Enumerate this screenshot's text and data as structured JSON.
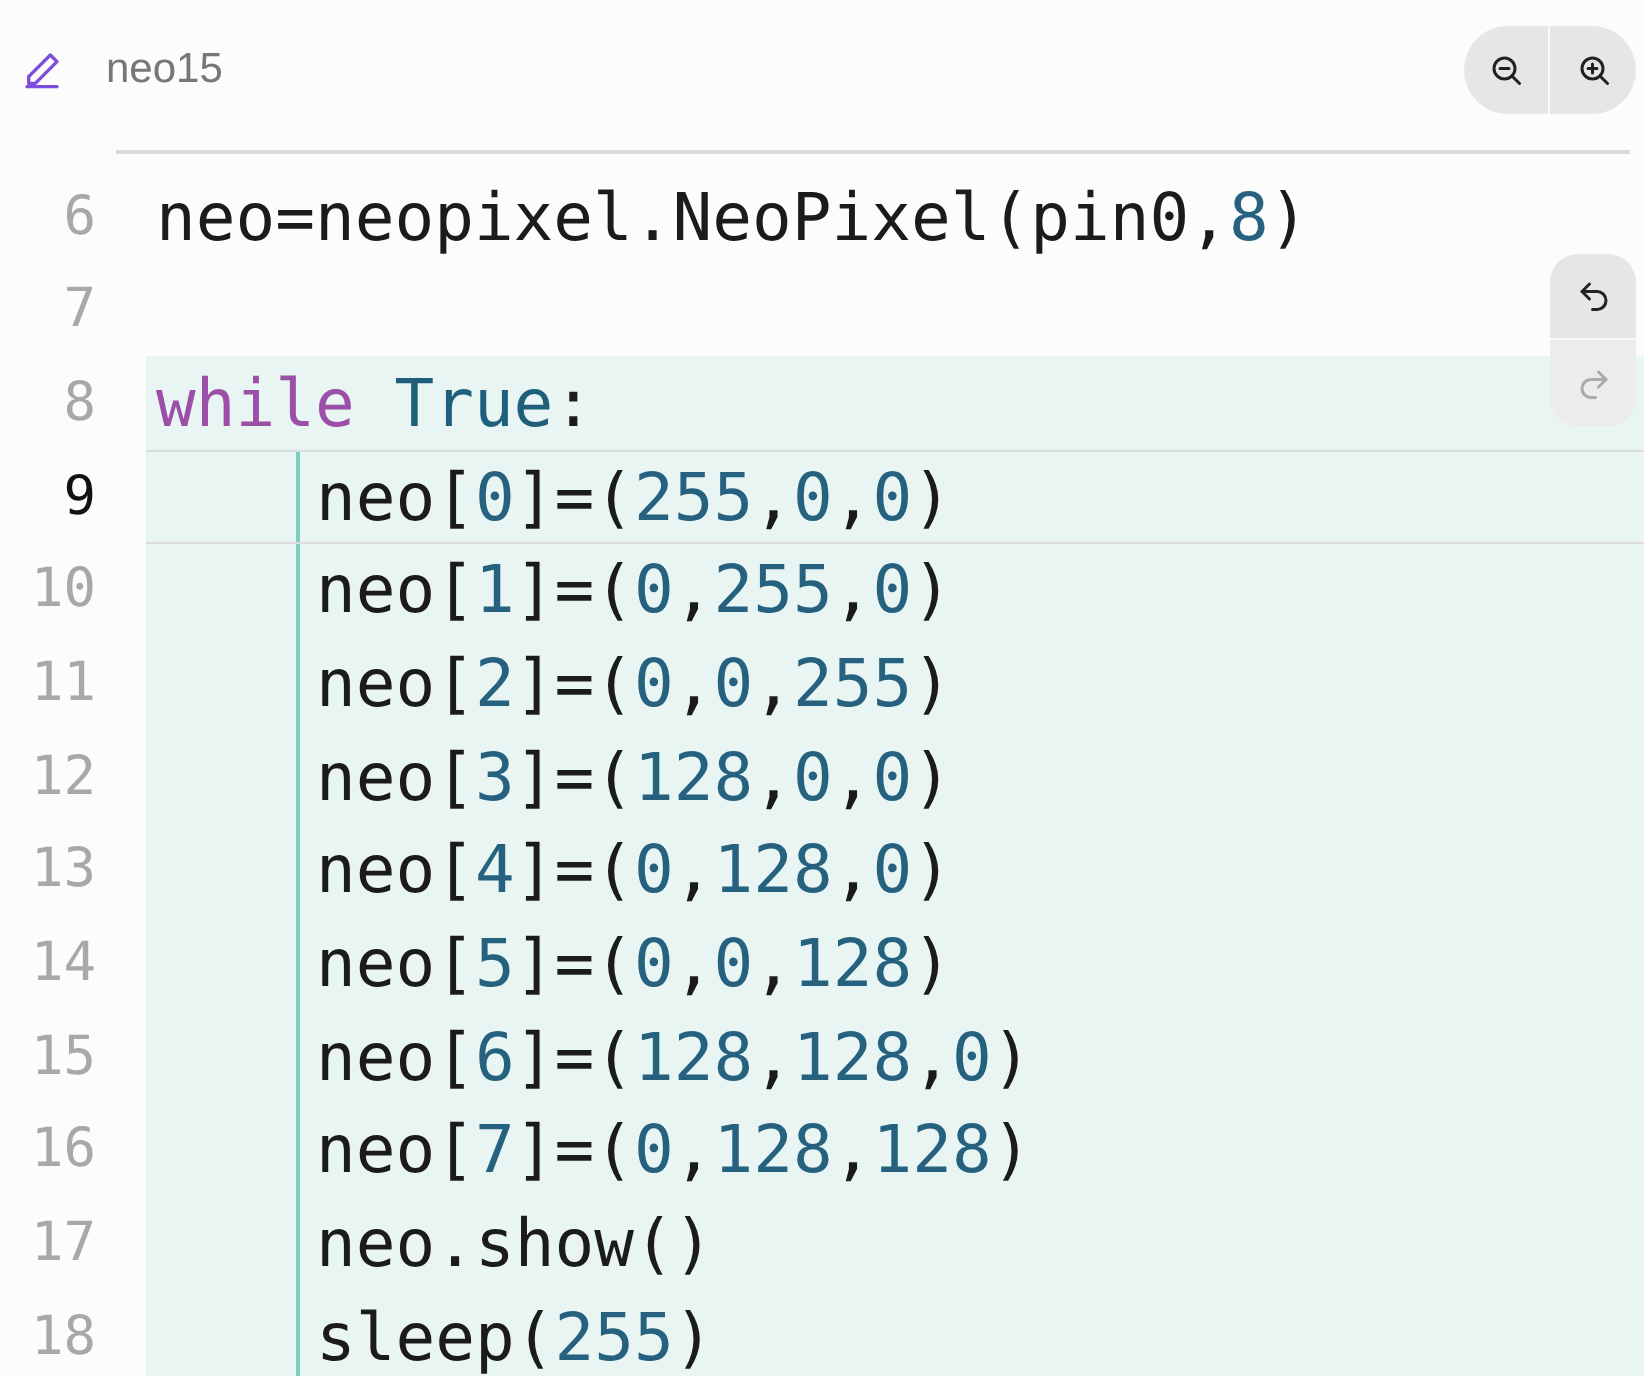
{
  "file": {
    "name": "neo15"
  },
  "lines": [
    {
      "number": "6",
      "active": false,
      "tokens": [
        {
          "text": "neo=neopixel.NeoPixel(pin0,",
          "kind": "plain"
        },
        {
          "text": "8",
          "kind": "number"
        },
        {
          "text": ")",
          "kind": "plain"
        }
      ]
    },
    {
      "number": "7",
      "active": false
    },
    {
      "number": "8",
      "active": false,
      "highlighted": true,
      "tokens": [
        {
          "text": "while",
          "kind": "keyword"
        },
        {
          "text": "True",
          "kind": "constant"
        },
        {
          "text": ":",
          "kind": "plain"
        }
      ],
      "children": [
        {
          "number": "9",
          "active": true,
          "tokens": [
            {
              "text": "neo[",
              "kind": "plain"
            },
            {
              "text": "0",
              "kind": "number"
            },
            {
              "text": "]=(",
              "kind": "plain"
            },
            {
              "text": "255",
              "kind": "number"
            },
            {
              "text": ",",
              "kind": "plain"
            },
            {
              "text": "0",
              "kind": "number"
            },
            {
              "text": ",",
              "kind": "plain"
            },
            {
              "text": "0",
              "kind": "number"
            },
            {
              "text": ")",
              "kind": "plain"
            }
          ]
        },
        {
          "number": "10",
          "active": false,
          "tokens": [
            {
              "text": "neo[",
              "kind": "plain"
            },
            {
              "text": "1",
              "kind": "number"
            },
            {
              "text": "]=(",
              "kind": "plain"
            },
            {
              "text": "0",
              "kind": "number"
            },
            {
              "text": ",",
              "kind": "plain"
            },
            {
              "text": "255",
              "kind": "number"
            },
            {
              "text": ",",
              "kind": "plain"
            },
            {
              "text": "0",
              "kind": "number"
            },
            {
              "text": ")",
              "kind": "plain"
            }
          ]
        },
        {
          "number": "11",
          "active": false,
          "tokens": [
            {
              "text": "neo[",
              "kind": "plain"
            },
            {
              "text": "2",
              "kind": "number"
            },
            {
              "text": "]=(",
              "kind": "plain"
            },
            {
              "text": "0",
              "kind": "number"
            },
            {
              "text": ",",
              "kind": "plain"
            },
            {
              "text": "0",
              "kind": "number"
            },
            {
              "text": ",",
              "kind": "plain"
            },
            {
              "text": "255",
              "kind": "number"
            },
            {
              "text": ")",
              "kind": "plain"
            }
          ]
        },
        {
          "number": "12",
          "active": false,
          "tokens": [
            {
              "text": "neo[",
              "kind": "plain"
            },
            {
              "text": "3",
              "kind": "number"
            },
            {
              "text": "]=(",
              "kind": "plain"
            },
            {
              "text": "128",
              "kind": "number"
            },
            {
              "text": ",",
              "kind": "plain"
            },
            {
              "text": "0",
              "kind": "number"
            },
            {
              "text": ",",
              "kind": "plain"
            },
            {
              "text": "0",
              "kind": "number"
            },
            {
              "text": ")",
              "kind": "plain"
            }
          ]
        },
        {
          "number": "13",
          "active": false,
          "tokens": [
            {
              "text": "neo[",
              "kind": "plain"
            },
            {
              "text": "4",
              "kind": "number"
            },
            {
              "text": "]=(",
              "kind": "plain"
            },
            {
              "text": "0",
              "kind": "number"
            },
            {
              "text": ",",
              "kind": "plain"
            },
            {
              "text": "128",
              "kind": "number"
            },
            {
              "text": ",",
              "kind": "plain"
            },
            {
              "text": "0",
              "kind": "number"
            },
            {
              "text": ")",
              "kind": "plain"
            }
          ]
        },
        {
          "number": "14",
          "active": false,
          "tokens": [
            {
              "text": "neo[",
              "kind": "plain"
            },
            {
              "text": "5",
              "kind": "number"
            },
            {
              "text": "]=(",
              "kind": "plain"
            },
            {
              "text": "0",
              "kind": "number"
            },
            {
              "text": ",",
              "kind": "plain"
            },
            {
              "text": "0",
              "kind": "number"
            },
            {
              "text": ",",
              "kind": "plain"
            },
            {
              "text": "128",
              "kind": "number"
            },
            {
              "text": ")",
              "kind": "plain"
            }
          ]
        },
        {
          "number": "15",
          "active": false,
          "tokens": [
            {
              "text": "neo[",
              "kind": "plain"
            },
            {
              "text": "6",
              "kind": "number"
            },
            {
              "text": "]=(",
              "kind": "plain"
            },
            {
              "text": "128",
              "kind": "number"
            },
            {
              "text": ",",
              "kind": "plain"
            },
            {
              "text": "128",
              "kind": "number"
            },
            {
              "text": ",",
              "kind": "plain"
            },
            {
              "text": "0",
              "kind": "number"
            },
            {
              "text": ")",
              "kind": "plain"
            }
          ]
        },
        {
          "number": "16",
          "active": false,
          "tokens": [
            {
              "text": "neo[",
              "kind": "plain"
            },
            {
              "text": "7",
              "kind": "number"
            },
            {
              "text": "]=(",
              "kind": "plain"
            },
            {
              "text": "0",
              "kind": "number"
            },
            {
              "text": ",",
              "kind": "plain"
            },
            {
              "text": "128",
              "kind": "number"
            },
            {
              "text": ",",
              "kind": "plain"
            },
            {
              "text": "128",
              "kind": "number"
            },
            {
              "text": ")",
              "kind": "plain"
            }
          ]
        },
        {
          "number": "17",
          "active": false,
          "tokens": [
            {
              "text": "neo.show()",
              "kind": "plain"
            }
          ]
        },
        {
          "number": "18",
          "active": false,
          "tokens": [
            {
              "text": "sleep(",
              "kind": "plain"
            },
            {
              "text": "255",
              "kind": "number"
            },
            {
              "text": ")",
              "kind": "plain"
            }
          ]
        }
      ]
    }
  ]
}
